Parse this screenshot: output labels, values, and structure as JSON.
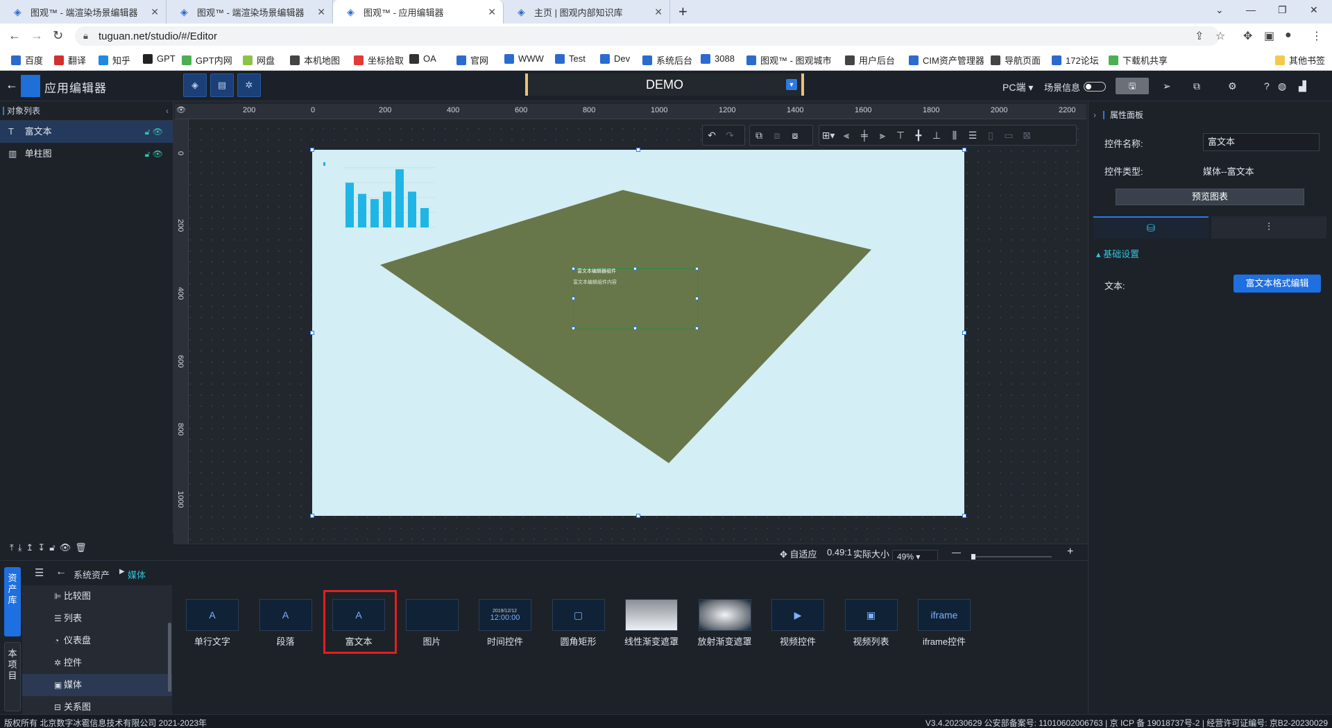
{
  "browser": {
    "tabs": [
      {
        "title": "图观™ - 端渲染场景编辑器",
        "active": false
      },
      {
        "title": "图观™ - 端渲染场景编辑器",
        "active": false
      },
      {
        "title": "图观™ - 应用编辑器",
        "active": true
      },
      {
        "title": "主页 | 图观内部知识库",
        "active": false
      }
    ],
    "url": "tuguan.net/studio/#/Editor",
    "bookmarks": [
      "百度",
      "翻译",
      "知乎",
      "GPT",
      "GPT内网",
      "网盘",
      "本机地图",
      "坐标拾取",
      "OA",
      "官网",
      "WWW",
      "Test",
      "Dev",
      "系统后台",
      "3088",
      "图观™ - 图观城市",
      "用户后台",
      "CIM资产管理器",
      "导航页面",
      "172论坛",
      "下载机共享"
    ],
    "other_bookmarks": "其他书签"
  },
  "app": {
    "title": "应用编辑器",
    "scene_name": "DEMO",
    "platform": "PC端",
    "scene_info_label": "场景信息",
    "accent": "#1e6fe0"
  },
  "object_list": {
    "title": "对象列表",
    "items": [
      {
        "label": "富文本",
        "icon": "text-icon",
        "selected": true
      },
      {
        "label": "单柱图",
        "icon": "bar-chart-icon",
        "selected": false
      }
    ]
  },
  "canvas": {
    "ruler_x": [
      "200",
      "0",
      "200",
      "400",
      "600",
      "800",
      "1000",
      "1200",
      "1400",
      "1600",
      "1800",
      "2000",
      "2200"
    ],
    "ruler_y": [
      "0",
      "200",
      "400",
      "600",
      "800",
      "1000"
    ],
    "stage_bg": "#d3eef4",
    "plane_color": "#68774a",
    "richtext_title": "富文本编辑器组件",
    "richtext_body": "富文本编辑组件内容",
    "mini_chart": {
      "values": [
        60,
        45,
        38,
        48,
        78,
        48,
        26
      ]
    }
  },
  "zoom": {
    "fit_label": "自适应",
    "ratio": "0.49:1",
    "actual_label": "实际大小",
    "percent": "49%"
  },
  "asset_library": {
    "side_tabs": [
      "资产库",
      "本项目"
    ],
    "breadcrumb_root": "系统资产",
    "breadcrumb_current": "媒体",
    "categories": [
      {
        "label": "比较图",
        "icon": "compare-chart-icon",
        "selected": false
      },
      {
        "label": "列表",
        "icon": "list-icon",
        "selected": false
      },
      {
        "label": "仪表盘",
        "icon": "gauge-icon",
        "selected": false
      },
      {
        "label": "控件",
        "icon": "gear-icon",
        "selected": false
      },
      {
        "label": "媒体",
        "icon": "media-icon",
        "selected": true
      },
      {
        "label": "关系图",
        "icon": "relation-icon",
        "selected": false
      }
    ],
    "cards": [
      {
        "label": "单行文字",
        "thumb": "A"
      },
      {
        "label": "段落",
        "thumb": "A"
      },
      {
        "label": "富文本",
        "thumb": "A"
      },
      {
        "label": "图片",
        "thumb": ""
      },
      {
        "label": "时间控件",
        "thumb": "12:00:00"
      },
      {
        "label": "圆角矩形",
        "thumb": "▢"
      },
      {
        "label": "线性渐变遮罩",
        "thumb": ""
      },
      {
        "label": "放射渐变遮罩",
        "thumb": ""
      },
      {
        "label": "视频控件",
        "thumb": "▶"
      },
      {
        "label": "视频列表",
        "thumb": "▣"
      },
      {
        "label": "iframe控件",
        "thumb": "iframe"
      }
    ],
    "time_thumb_date": "2019/12/12"
  },
  "properties": {
    "title": "属性面板",
    "name_label": "控件名称:",
    "name_value": "富文本",
    "type_label": "控件类型:",
    "type_value": "媒体--富文本",
    "preview_button": "预览图表",
    "section": "基础设置",
    "text_label": "文本:",
    "text_button": "富文本格式编辑"
  },
  "footer": {
    "copyright": "版权所有 北京数字冰雹信息技术有限公司 2021-2023年",
    "version": "V3.4.20230629 公安部备案号: 11010602006763 | 京 ICP 备 19018737号-2 | 经营许可证编号: 京B2-20230029"
  }
}
